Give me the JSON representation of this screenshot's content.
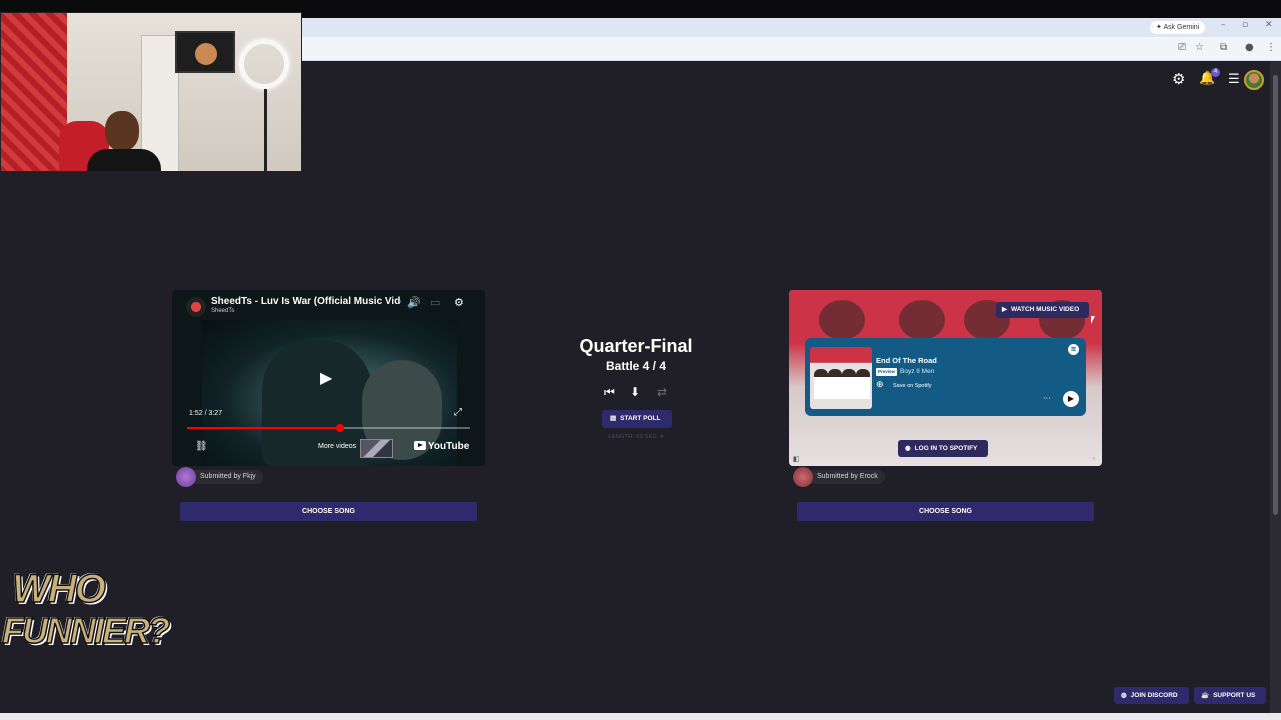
{
  "browser": {
    "gemini_label": "Ask Gemini",
    "minimize_icon": "minimize-icon",
    "restore_icon": "restore-icon",
    "close_icon": "close-icon"
  },
  "header": {
    "settings_icon": "gear-icon",
    "notifications_icon": "bell-icon",
    "notification_count": "4",
    "menu_icon": "hamburger-icon"
  },
  "stream_overlay": {
    "logo_line1": "WHO",
    "logo_line2": "FUNNIER?"
  },
  "left_song": {
    "video_title": "SheedTs - Luv Is War (Official Music Vide",
    "channel": "SheedTs",
    "time": "1:52 / 3:27",
    "progress_fraction": 0.54,
    "more_videos": "More videos",
    "youtube_label": "YouTube",
    "submitted_by": "Submitted by Fkjy",
    "choose_label": "CHOOSE SONG"
  },
  "battle": {
    "round": "Quarter-Final",
    "battle_label": "Battle 4 / 4",
    "start_poll": "START POLL",
    "length": "LENGTH: 60 SEC. ▾"
  },
  "right_song": {
    "watch_label": "WATCH MUSIC VIDEO",
    "track_title": "End Of The Road",
    "preview_tag": "Preview",
    "artist": "Boyz II Men",
    "save_label": "Save on Spotify",
    "login_label": "LOG IN TO SPOTIFY",
    "submitted_by": "Submitted by Erock",
    "choose_label": "CHOOSE SONG"
  },
  "footer": {
    "discord": "JOIN DISCORD",
    "support": "SUPPORT US"
  },
  "colors": {
    "page_bg": "#201f28",
    "accent_button": "#2f2a6b",
    "spotify_card": "#135a84",
    "youtube_progress": "#ff0000"
  }
}
